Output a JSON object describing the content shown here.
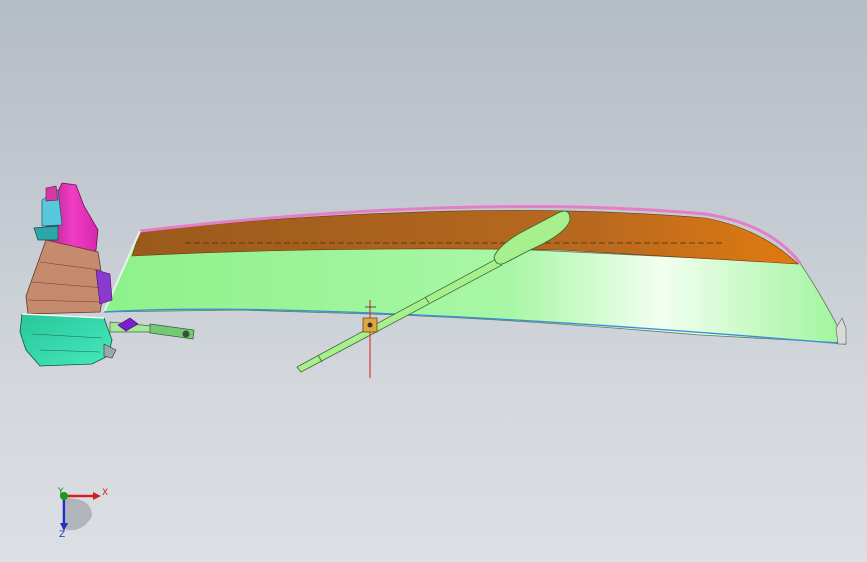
{
  "triad": {
    "x_label": "X",
    "y_label": "Y",
    "z_label": "Z"
  },
  "colors": {
    "background_top": "#b4bcc6",
    "background_bottom": "#dcdfe3",
    "hull_side": "#9df79a",
    "hull_interior": "#b0611c",
    "gunwale": "#e47fc7",
    "oar": "#a8f08e",
    "motor_cowl": "#e82bb8",
    "motor_body": "#c68a6e",
    "motor_lower": "#2ed7a9",
    "x_axis": "#d02020",
    "y_axis": "#1a8a1a",
    "z_axis": "#2030c0"
  }
}
